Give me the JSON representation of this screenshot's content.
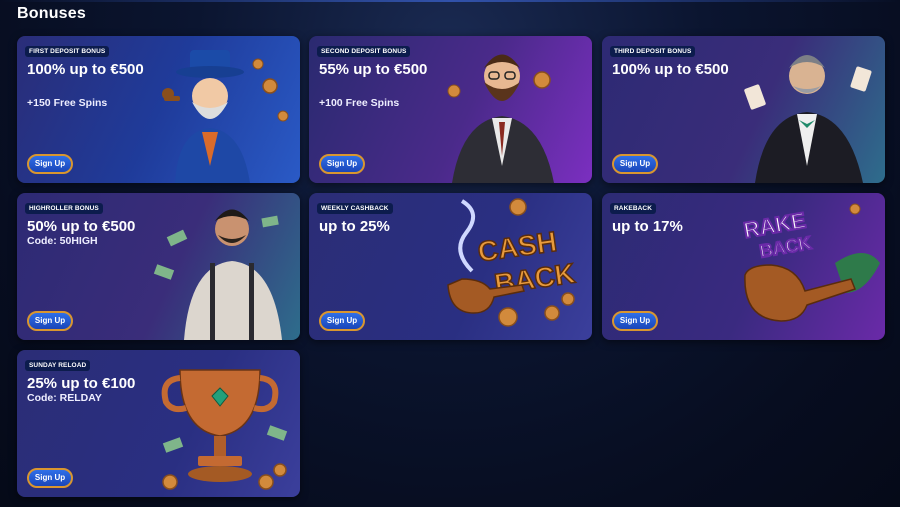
{
  "page": {
    "title": "Bonuses"
  },
  "cards": [
    {
      "tag": "FIRST DEPOSIT BONUS",
      "headline": "100% up to €500",
      "sub": "+150 Free Spins",
      "button": "Sign Up",
      "art": "wizard-gentleman-pipe"
    },
    {
      "tag": "SECOND DEPOSIT BONUS",
      "headline": "55% up to €500",
      "sub": "+100 Free Spins",
      "button": "Sign Up",
      "art": "bearded-man-suit"
    },
    {
      "tag": "THIRD DEPOSIT BONUS",
      "headline": "100% up to €500",
      "sub": "",
      "button": "Sign Up",
      "art": "gentleman-cards"
    },
    {
      "tag": "HIGHROLLER BONUS",
      "headline": "50% up to €500",
      "sub": "Code: 50HIGH",
      "button": "Sign Up",
      "art": "tattooed-man-money"
    },
    {
      "tag": "WEEKLY CASHBACK",
      "headline": "up to 25%",
      "sub": "",
      "button": "Sign Up",
      "art": "cashback-pipe-coins"
    },
    {
      "tag": "RAKEBACK",
      "headline": "up to 17%",
      "sub": "",
      "button": "Sign Up",
      "art": "rakeback-pipe"
    },
    {
      "tag": "SUNDAY RELOAD",
      "headline": "25% up to €100",
      "sub": "Code: RELDAY",
      "button": "Sign Up",
      "art": "trophy-coins"
    }
  ],
  "colors": {
    "button_border": "#d9962f",
    "button_fill": "#2f6fe8",
    "tag_bg": "#0c1c4d",
    "coin": "#d28a3c"
  }
}
